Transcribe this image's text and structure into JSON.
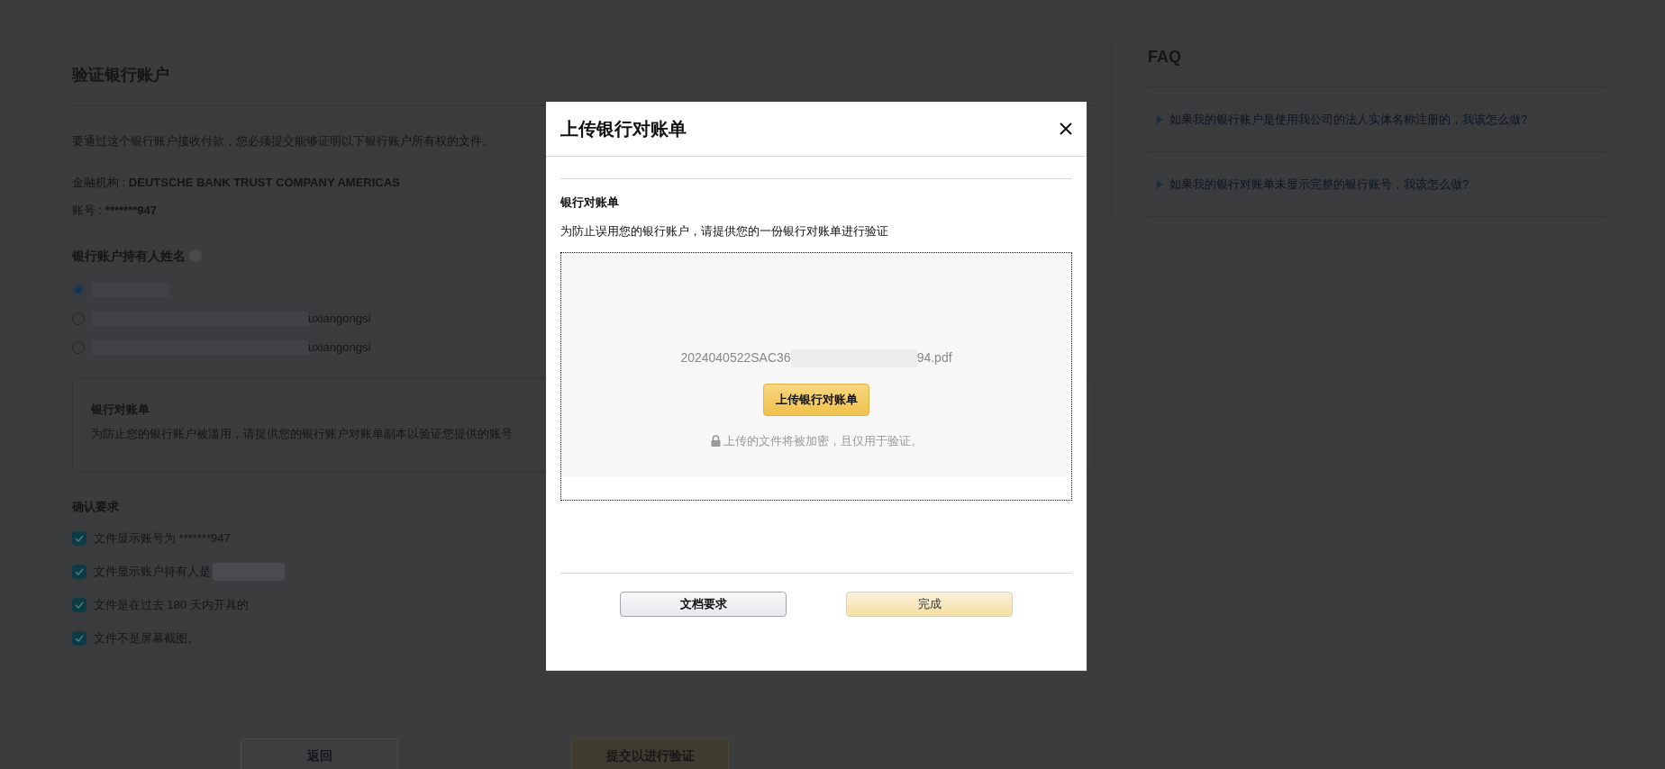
{
  "page": {
    "title": "验证银行账户",
    "description": "要通过这个银行账户接收付款，您必须提交能够证明以下银行账户所有权的文件。",
    "institution": {
      "label": "金融机构 : ",
      "value": "DEUTSCHE BANK TRUST COMPANY AMERICAS"
    },
    "account": {
      "label": "账号 : ",
      "value": "*******947"
    },
    "holder": {
      "label": "银行账户持有人姓名",
      "options": [
        {
          "selected": true
        },
        {
          "text": "uxiangongsi",
          "selected": false
        },
        {
          "text": "uxiangongsi",
          "selected": false
        }
      ]
    },
    "statement": {
      "title": "银行对账单",
      "description": "为防止您的银行账户被滥用，请提供您的银行账户对账单副本以验证您提供的账号"
    },
    "requirements": {
      "title": "确认要求",
      "items": [
        {
          "text": "文件显示账号为 *******947",
          "checked": true,
          "redacted": false
        },
        {
          "text": "文件显示账户持有人是",
          "checked": true,
          "redacted": true
        },
        {
          "text": "文件是在过去 180 天内开具的",
          "checked": true,
          "redacted": false
        },
        {
          "text": "文件不是屏幕截图。",
          "checked": true,
          "redacted": false
        }
      ]
    },
    "buttons": [
      {
        "label": "返回",
        "kind": "secondary"
      },
      {
        "label": "提交以进行验证",
        "kind": "primary"
      }
    ]
  },
  "faq": {
    "title": "FAQ",
    "items": [
      {
        "text": "如果我的银行账户是使用我公司的法人实体名称注册的，我该怎么做?",
        "expanded": false
      },
      {
        "text": "如果我的银行对账单未显示完整的银行账号，我该怎么做?",
        "expanded": false
      }
    ]
  },
  "modal": {
    "title": "上传银行对账单",
    "section_title": "银行对账单",
    "description": "为防止误用您的银行账户，请提供您的一份银行对账单进行验证",
    "file_name_start": "2024040522SAC36",
    "file_name_end": "94.pdf",
    "upload_button": "上传银行对账单",
    "note": "上传的文件将被加密，且仅用于验证。",
    "buttons": [
      {
        "label": "文档要求",
        "kind": "secondary"
      },
      {
        "label": "完成",
        "kind": "primary"
      }
    ]
  }
}
